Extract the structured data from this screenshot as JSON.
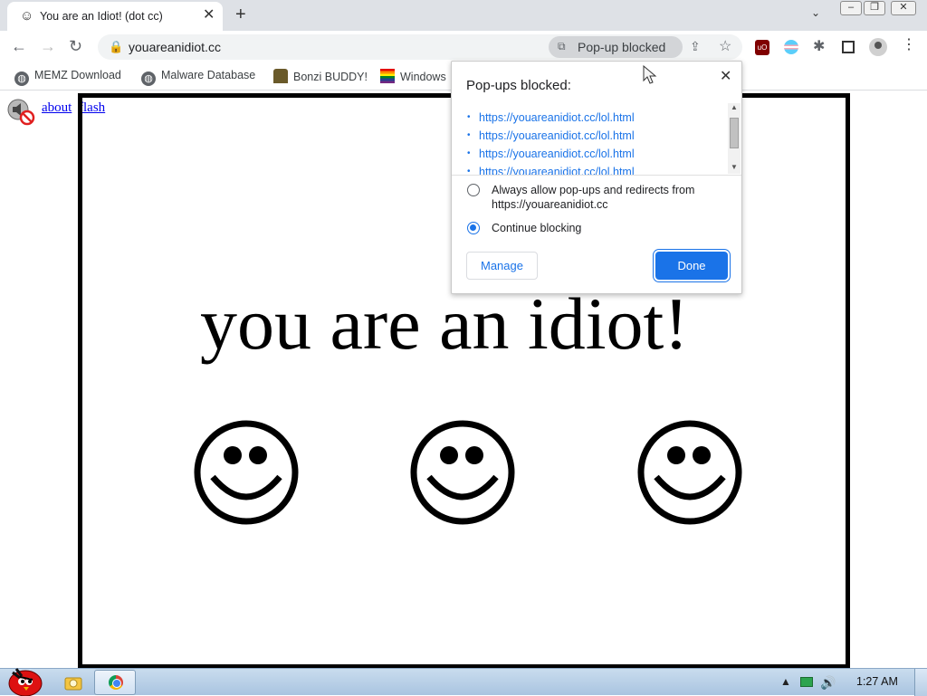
{
  "browser": {
    "tab": {
      "favicon": "smiley-icon",
      "title": "You are an Idiot! (dot cc)"
    },
    "window_buttons": [
      "minimize",
      "restore",
      "close"
    ],
    "address": {
      "url": "youareanidiot.cc",
      "popup_chip_label": "Pop-up blocked"
    },
    "bookmarks": [
      {
        "label": "MEMZ Download",
        "icon": "globe-icon"
      },
      {
        "label": "Malware Database",
        "icon": "globe-icon"
      },
      {
        "label": "Bonzi BUDDY!",
        "icon": "bonzi-icon"
      },
      {
        "label": "Windows",
        "icon": "rainbow-flag-icon"
      }
    ]
  },
  "page": {
    "links": {
      "about": "about",
      "flash": "flash"
    },
    "headline": "you are an idiot!"
  },
  "popup_bubble": {
    "title": "Pop-ups blocked:",
    "blocked_urls": [
      "https://youareanidiot.cc/lol.html",
      "https://youareanidiot.cc/lol.html",
      "https://youareanidiot.cc/lol.html",
      "https://youareanidiot.cc/lol.html"
    ],
    "options": [
      {
        "label": "Always allow pop-ups and redirects from https://youareanidiot.cc",
        "selected": false
      },
      {
        "label": "Continue blocking",
        "selected": true
      }
    ],
    "manage_label": "Manage",
    "done_label": "Done"
  },
  "taskbar": {
    "clock": "1:27 AM"
  },
  "colors": {
    "accent": "#1a73e8",
    "tabstrip": "#dee1e6",
    "link": "#0000ee"
  }
}
